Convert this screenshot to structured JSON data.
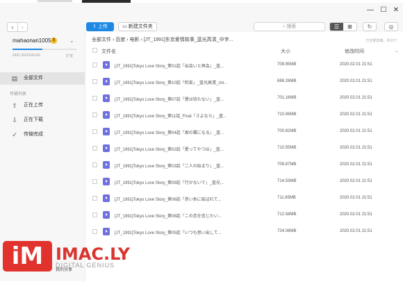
{
  "window": {
    "minimize": "—",
    "maximize": "☐",
    "close": "✕"
  },
  "toolbar": {
    "upload": "上传",
    "new_folder": "新建文件夹",
    "search_placeholder": "搜索"
  },
  "user": {
    "name": "mahaonan1005",
    "quota_text": "2431.3G/5140.0G",
    "quota_fraction": 0.47,
    "expand": "扩容"
  },
  "sidebar": {
    "all_files": "全部文件",
    "transfers_title": "传输列表",
    "uploading": "正在上传",
    "downloading": "正在下载",
    "completed": "传输完成",
    "my_share": "我的分享"
  },
  "main": {
    "breadcrumb": "全部文件 › 百度 › 电影 › [JT_1991]东京爱情故事_蓝光高清_中字...",
    "loaded_status": "已全部加载，共13个",
    "columns": {
      "name": "文件名",
      "size": "大小",
      "time": "修改时间"
    },
    "files": [
      {
        "name": "[JT_1991]Tokyo Love Story_第01話「出会いと再会」_蓝...",
        "size": "708.95MB",
        "time": "2020.02.01 21:51"
      },
      {
        "name": "[JT_1991]Tokyo Love Story_第10話「約束」_蓝光高清_chi...",
        "size": "688.26MB",
        "time": "2020.02.01 21:51"
      },
      {
        "name": "[JT_1991]Tokyo Love Story_第07話「愛は待たない」_蓝...",
        "size": "701.16MB",
        "time": "2020.02.01 21:51"
      },
      {
        "name": "[JT_1991]Tokyo Love Story_第11話_Final「さよなら」_蓝...",
        "size": "710.06MB",
        "time": "2020.02.01 21:51"
      },
      {
        "name": "[JT_1991]Tokyo Love Story_第04話「君の翼になる」_蓝...",
        "size": "700.82MB",
        "time": "2020.02.01 21:51"
      },
      {
        "name": "[JT_1991]Tokyo Love Story_第02話「愛ってやつは」_蓝...",
        "size": "710.55MB",
        "time": "2020.02.01 21:51"
      },
      {
        "name": "[JT_1991]Tokyo Love Story_第03話「二人の始まり」_蓝...",
        "size": "709.87MB",
        "time": "2020.02.01 21:51"
      },
      {
        "name": "[JT_1991]Tokyo Love Story_第09話「行かないで」_蓝光...",
        "size": "714.53MB",
        "time": "2020.02.01 21:51"
      },
      {
        "name": "[JT_1991]Tokyo Love Story_第06話「赤い糸に結ばれて...",
        "size": "711.65MB",
        "time": "2020.02.01 21:51"
      },
      {
        "name": "[JT_1991]Tokyo Love Story_第08話「この恋を信じたい...",
        "size": "712.58MB",
        "time": "2020.02.01 21:51"
      },
      {
        "name": "[JT_1991]Tokyo Love Story_第05話「いつも思い出して...",
        "size": "724.08MB",
        "time": "2020.02.01 21:51"
      }
    ]
  },
  "watermark": {
    "logo": "iM",
    "name": "IMAC.LY",
    "tagline": "DIGITAL GENIUS"
  },
  "colors": {
    "accent": "#1e88e5",
    "file_icon": "#6f6fe0",
    "watermark": "#e2322e"
  }
}
